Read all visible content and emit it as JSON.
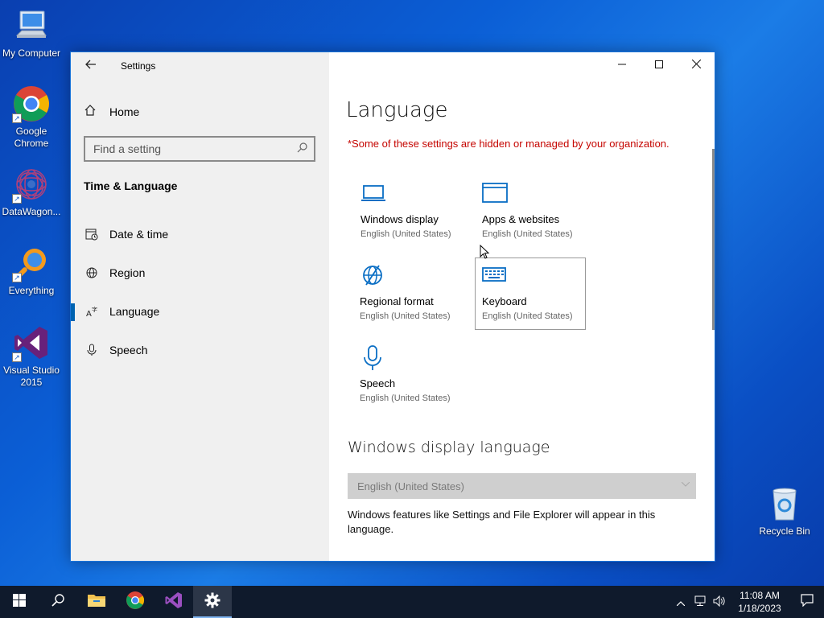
{
  "desktop": {
    "icons": [
      {
        "label": "My Computer"
      },
      {
        "label": "Google Chrome"
      },
      {
        "label": "DataWagon..."
      },
      {
        "label": "Everything"
      },
      {
        "label": "Visual Studio 2015"
      },
      {
        "label": "Recycle Bin"
      }
    ]
  },
  "window": {
    "title": "Settings",
    "sidebar": {
      "home_label": "Home",
      "search_placeholder": "Find a setting",
      "section_title": "Time & Language",
      "items": [
        {
          "label": "Date & time",
          "icon": "calendar-clock-icon"
        },
        {
          "label": "Region",
          "icon": "globe-icon"
        },
        {
          "label": "Language",
          "icon": "language-icon",
          "active": true
        },
        {
          "label": "Speech",
          "icon": "microphone-icon"
        }
      ]
    },
    "content": {
      "page_title": "Language",
      "warning": "*Some of these settings are hidden or managed by your organization.",
      "tiles": [
        {
          "name": "Windows display",
          "sub": "English (United States)",
          "icon": "laptop-icon"
        },
        {
          "name": "Apps & websites",
          "sub": "English (United States)",
          "icon": "window-icon"
        },
        {
          "name": "Regional format",
          "sub": "English (United States)",
          "icon": "regional-globe-icon"
        },
        {
          "name": "Keyboard",
          "sub": "English (United States)",
          "icon": "keyboard-icon"
        },
        {
          "name": "Speech",
          "sub": "English (United States)",
          "icon": "microphone-icon"
        }
      ],
      "display_language_heading": "Windows display language",
      "display_language_value": "English (United States)",
      "display_language_desc": "Windows features like Settings and File Explorer will appear in this language."
    }
  },
  "taskbar": {
    "apps": [
      "start",
      "search",
      "file-explorer",
      "chrome",
      "visual-studio",
      "settings"
    ],
    "active_app": "settings",
    "time": "11:08 AM",
    "date": "1/18/2023"
  },
  "colors": {
    "accent": "#0063b1",
    "warning": "#c50500",
    "icon_blue": "#0a6ec4"
  }
}
